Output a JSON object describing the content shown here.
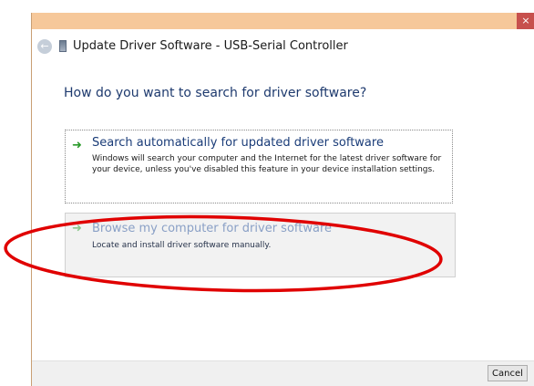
{
  "window": {
    "title": "Update Driver Software - USB-Serial Controller",
    "close_glyph": "×"
  },
  "content": {
    "question": "How do you want to search for driver software?",
    "options": [
      {
        "label": "Search automatically for updated driver software",
        "description": "Windows will search your computer and the Internet for the latest driver software for your device, unless you've disabled this feature in your device installation settings.",
        "icon": "green-arrow-icon"
      },
      {
        "label": "Browse my computer for driver software",
        "description": "Locate and install driver software manually.",
        "icon": "green-arrow-icon"
      }
    ]
  },
  "footer": {
    "cancel_label": "Cancel"
  },
  "colors": {
    "accent": "#1a3c78",
    "arrow": "#2a9a2a",
    "annotation_ellipse": "#e00000",
    "close_button": "#c7504d"
  }
}
